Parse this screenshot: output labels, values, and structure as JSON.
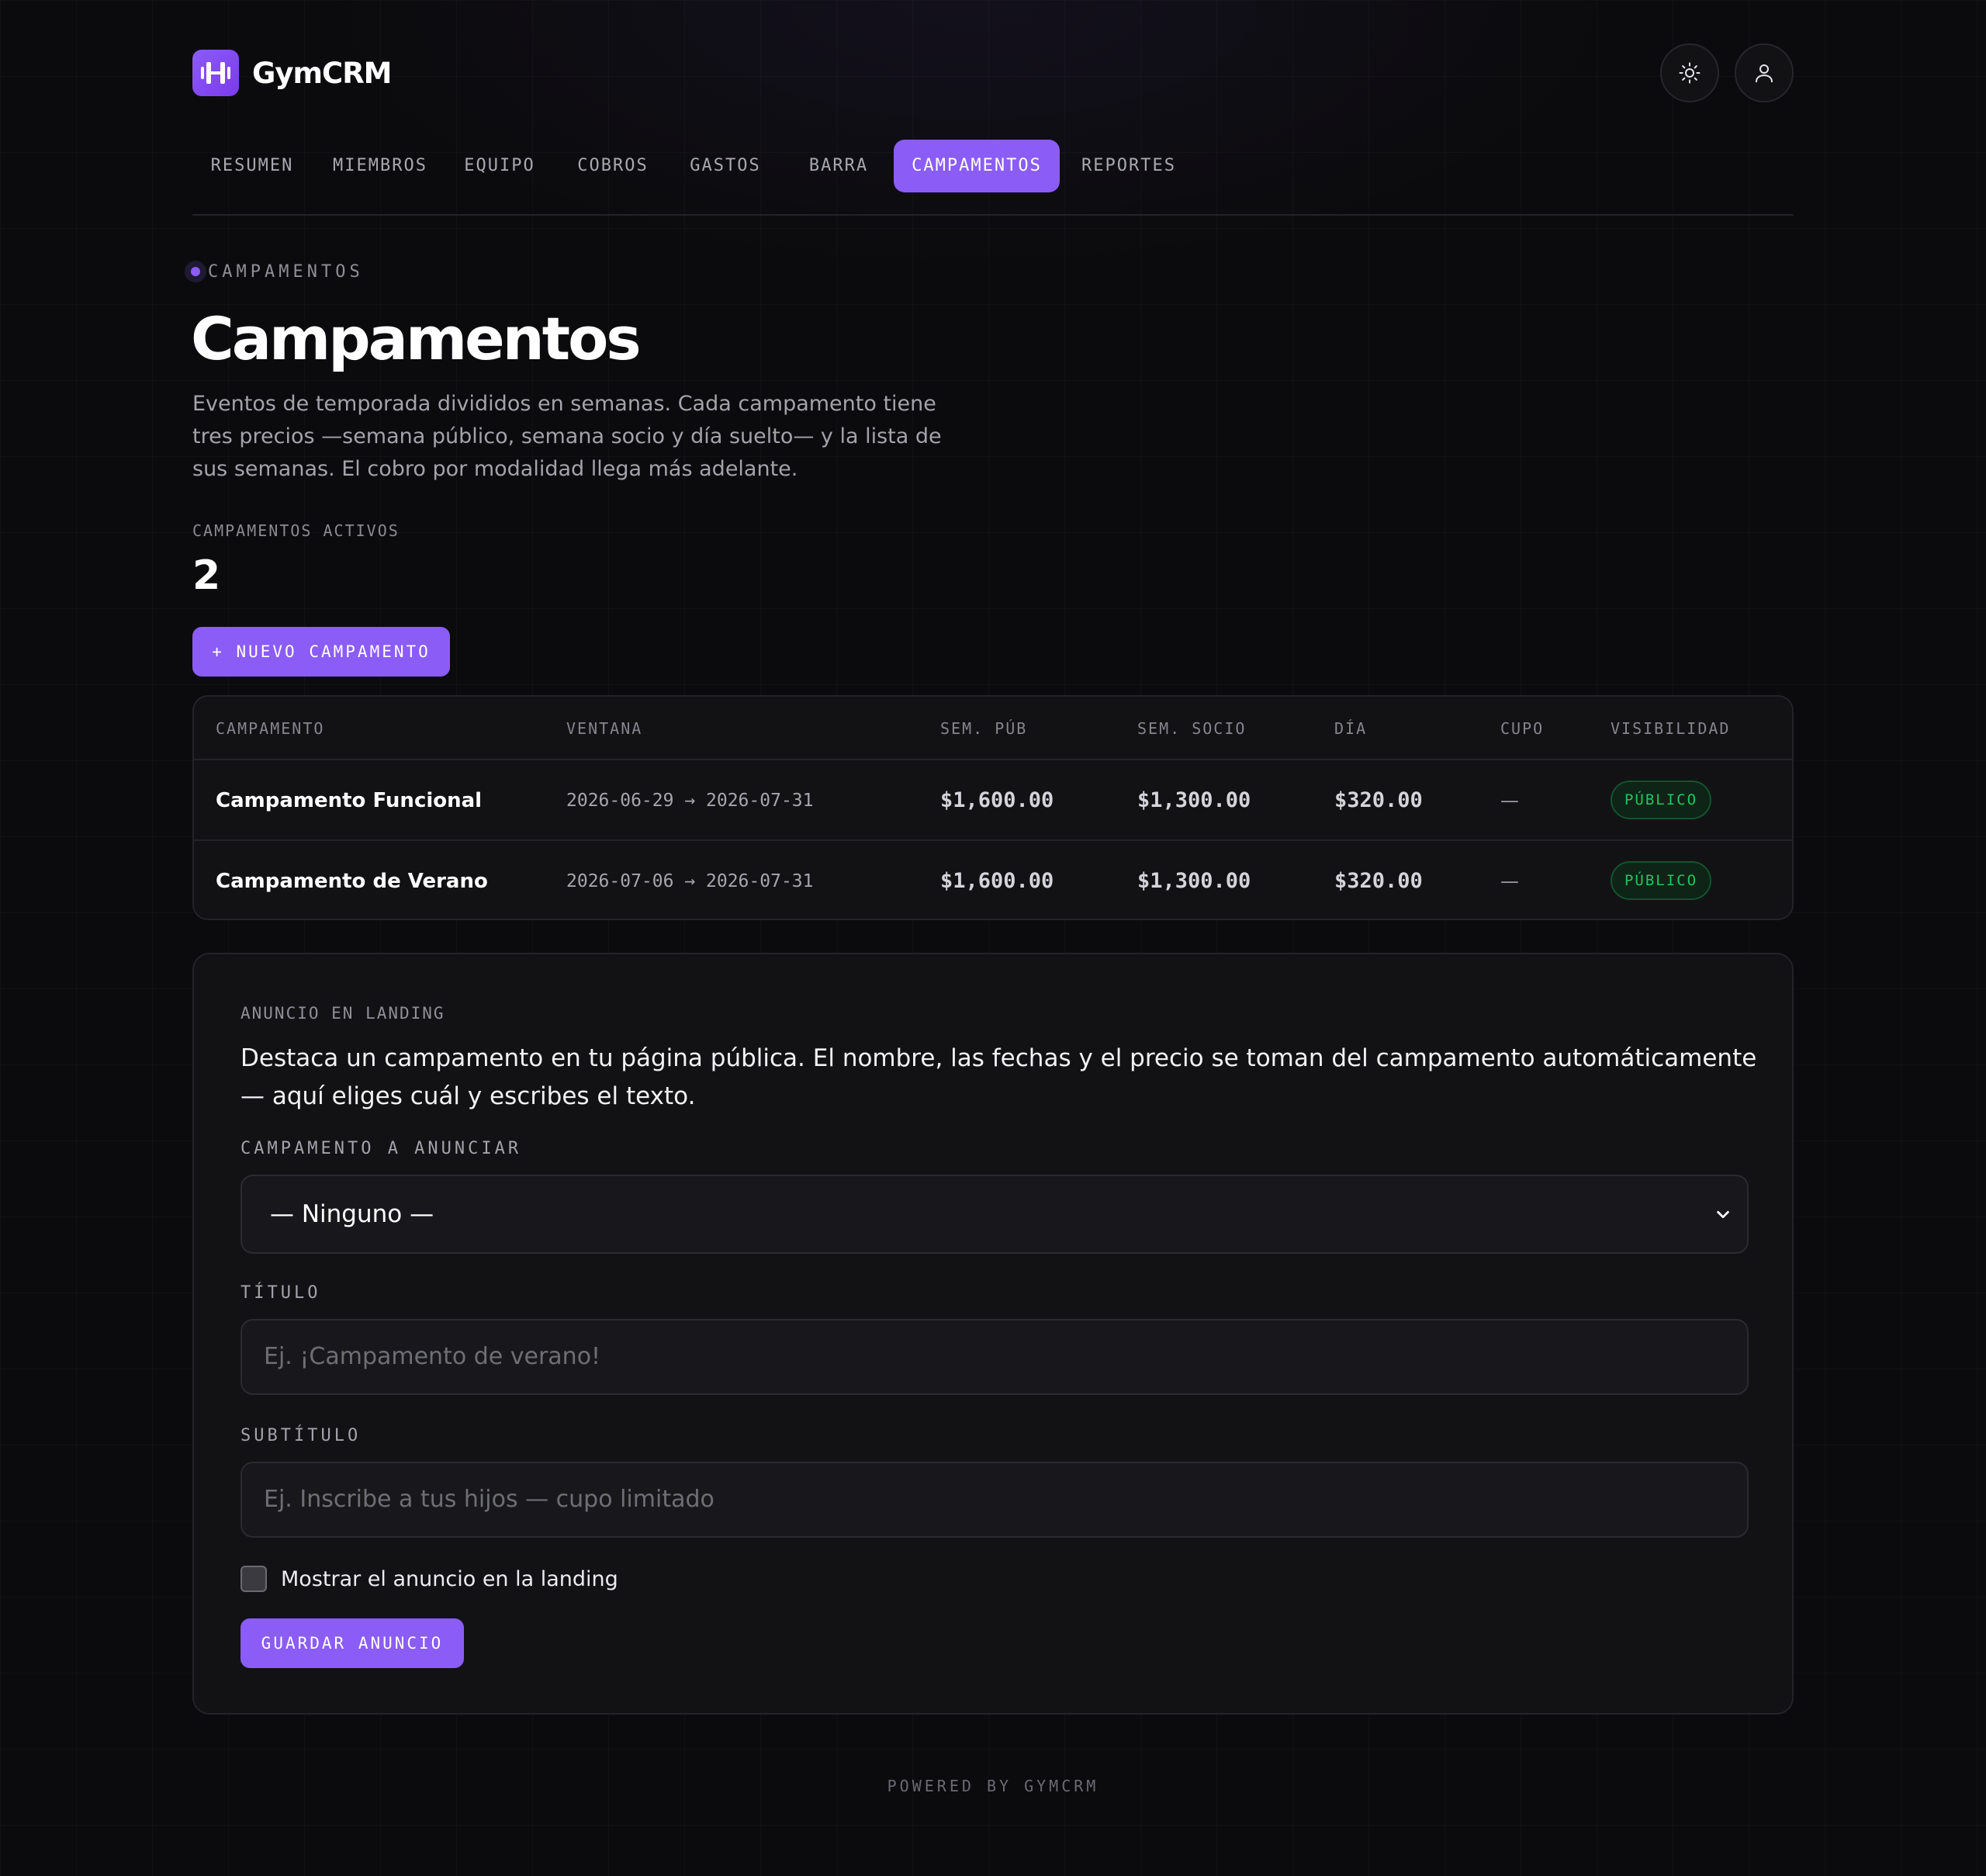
{
  "app": {
    "name": "GymCRM",
    "logo_icon": "barbell-icon",
    "accent_color": "#8b5cf6"
  },
  "header_actions": {
    "theme_icon": "sun-icon",
    "account_icon": "user-icon"
  },
  "nav": {
    "items": [
      {
        "label": "RESUMEN"
      },
      {
        "label": "MIEMBROS"
      },
      {
        "label": "EQUIPO"
      },
      {
        "label": "COBROS"
      },
      {
        "label": "GASTOS"
      },
      {
        "label": "BARRA"
      },
      {
        "label": "CAMPAMENTOS",
        "active": true
      },
      {
        "label": "REPORTES"
      }
    ]
  },
  "page": {
    "eyebrow": "CAMPAMENTOS",
    "title": "Campamentos",
    "description": "Eventos de temporada divididos en semanas. Cada campamento tiene tres precios —semana público, semana socio y día suelto— y la lista de sus semanas. El cobro por modalidad llega más adelante."
  },
  "stats": {
    "label": "CAMPAMENTOS ACTIVOS",
    "value": "2"
  },
  "actions": {
    "new_camp": "+ NUEVO CAMPAMENTO"
  },
  "table": {
    "headers": [
      "CAMPAMENTO",
      "VENTANA",
      "SEM. PÚB",
      "SEM. SOCIO",
      "DÍA",
      "CUPO",
      "VISIBILIDAD"
    ],
    "rows": [
      {
        "name": "Campamento Funcional",
        "window": "2026-06-29 → 2026-07-31",
        "week_public": "$1,600.00",
        "week_member": "$1,300.00",
        "day": "$320.00",
        "quota": "—",
        "visibility": "PÚBLICO"
      },
      {
        "name": "Campamento de Verano",
        "window": "2026-07-06 → 2026-07-31",
        "week_public": "$1,600.00",
        "week_member": "$1,300.00",
        "day": "$320.00",
        "quota": "—",
        "visibility": "PÚBLICO"
      }
    ]
  },
  "announcement": {
    "label": "ANUNCIO EN LANDING",
    "description": "Destaca un campamento en tu página pública. El nombre, las fechas y el precio se toman del campamento automáticamente — aquí eliges cuál y escribes el texto.",
    "camp_label": "CAMPAMENTO A ANUNCIAR",
    "camp_selected": "— Ninguno —",
    "title_label": "TÍTULO",
    "title_placeholder": "Ej. ¡Campamento de verano!",
    "subtitle_label": "SUBTÍTULO",
    "subtitle_placeholder": "Ej. Inscribe a tus hijos — cupo limitado",
    "show_label": "Mostrar el anuncio en la landing",
    "show_checked": false,
    "save_label": "GUARDAR ANUNCIO"
  },
  "footer": {
    "text": "POWERED BY GYMCRM"
  }
}
